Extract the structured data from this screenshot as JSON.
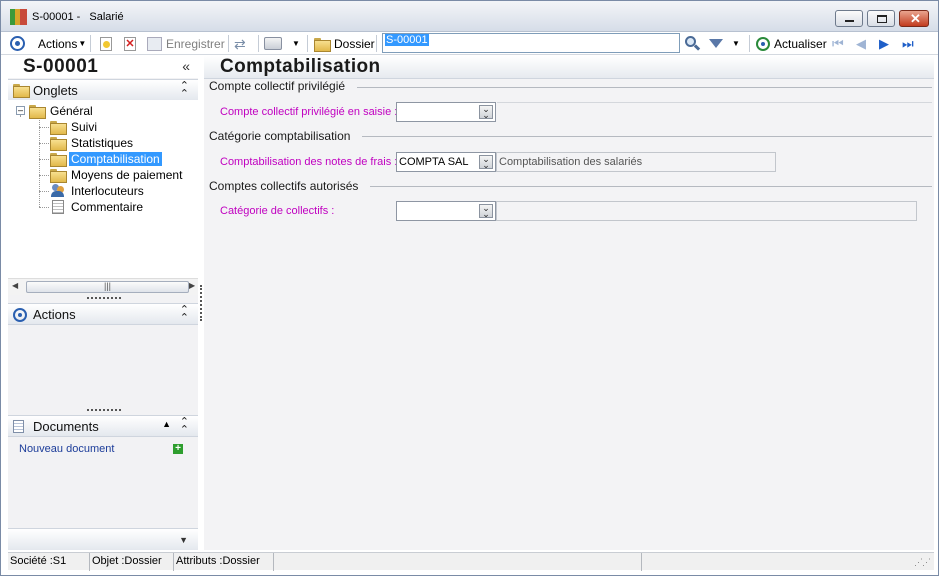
{
  "window": {
    "title_code": "S-00001 -",
    "title_name": "Salarié"
  },
  "toolbar": {
    "actions_label": "Actions",
    "save_label": "Enregistrer",
    "folder_label": "Dossier",
    "search_value": "S-00001",
    "refresh_label": "Actualiser"
  },
  "left": {
    "record_code": "S-00001",
    "tabs_header": "Onglets",
    "tree": [
      {
        "label": "Général"
      },
      {
        "label": "Suivi"
      },
      {
        "label": "Statistiques"
      },
      {
        "label": "Comptabilisation"
      },
      {
        "label": "Moyens de paiement"
      },
      {
        "label": "Interlocuteurs"
      },
      {
        "label": "Commentaire"
      }
    ],
    "actions_header": "Actions",
    "documents_header": "Documents",
    "new_document_link": "Nouveau document"
  },
  "content": {
    "title": "Comptabilisation",
    "groups": {
      "g1": "Compte collectif privilégié",
      "g2": "Catégorie comptabilisation",
      "g3": "Comptes collectifs autorisés"
    },
    "fields": {
      "f1_label": "Compte collectif privilégié en saisie :",
      "f1_value": "",
      "f2_label": "Comptabilisation des notes de frais :",
      "f2_value": "COMPTA SAL",
      "f2_desc": "Comptabilisation des salariés",
      "f3_label": "Catégorie de collectifs :",
      "f3_value": "",
      "f3_desc": ""
    }
  },
  "status": {
    "societe": "Société :S1",
    "objet": "Objet :Dossier",
    "attributs": "Attributs :Dossier"
  },
  "colors": {
    "selection": "#3399ff",
    "field_label": "#c000c0",
    "link": "#1d3d9a"
  }
}
